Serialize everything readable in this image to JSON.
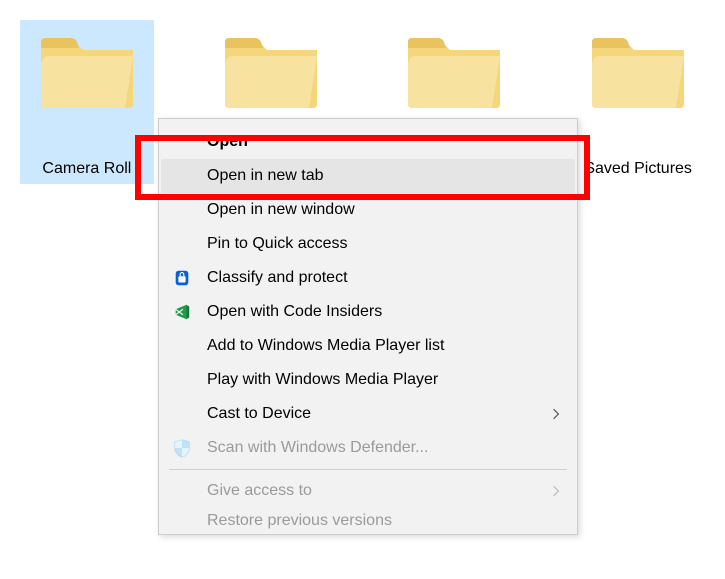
{
  "folders": [
    {
      "label": "Camera Roll",
      "selected": true
    },
    {
      "label": "",
      "selected": false
    },
    {
      "label": "",
      "selected": false
    },
    {
      "label": "Saved Pictures",
      "selected": false
    }
  ],
  "context_menu": {
    "items": [
      {
        "label": "Open",
        "bold": true
      },
      {
        "label": "Open in new tab",
        "hovered": true
      },
      {
        "label": "Open in new window"
      },
      {
        "label": "Pin to Quick access"
      },
      {
        "label": "Classify and protect",
        "icon": "lock-icon"
      },
      {
        "label": "Open with Code Insiders",
        "icon": "vscode-icon"
      },
      {
        "label": "Add to Windows Media Player list"
      },
      {
        "label": "Play with Windows Media Player"
      },
      {
        "label": "Cast to Device",
        "submenu": true
      },
      {
        "label": "Scan with Windows Defender...",
        "icon": "shield-icon",
        "disabled": true
      },
      {
        "separator": true
      },
      {
        "label": "Give access to",
        "disabled": true,
        "submenu": true
      },
      {
        "label": "Restore previous versions",
        "disabled": true,
        "cutoff": true
      }
    ]
  },
  "annotation": {
    "highlight_color": "#ff0000"
  }
}
